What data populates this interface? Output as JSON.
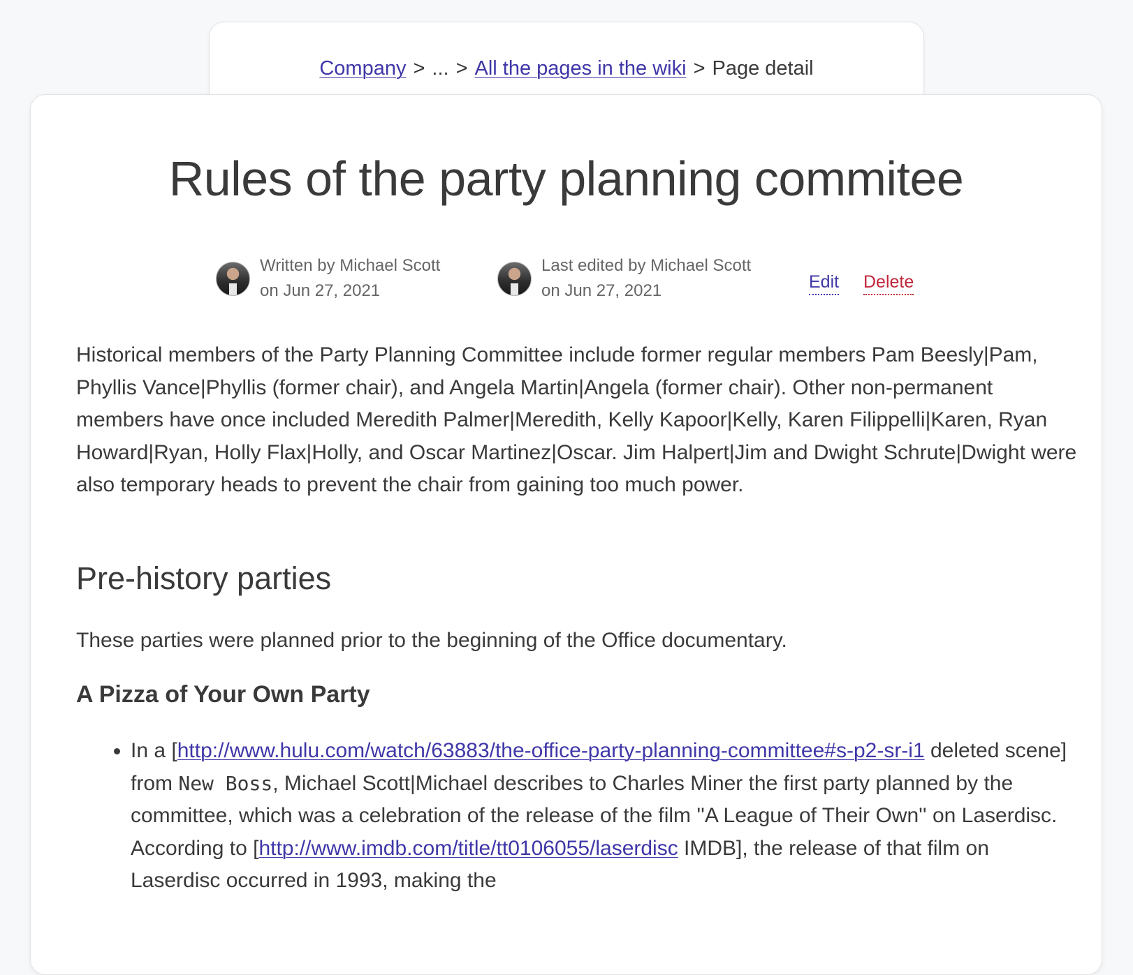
{
  "breadcrumb": {
    "company": "Company",
    "sep1": ">",
    "ellipsis": "...",
    "sep2": ">",
    "all_pages": "All the pages in the wiki",
    "sep3": ">",
    "current": "Page detail"
  },
  "page": {
    "title": "Rules of the party planning commitee"
  },
  "meta": {
    "written_line1": "Written by Michael Scott",
    "written_line2": "on Jun 27, 2021",
    "edited_line1": "Last edited by Michael Scott",
    "edited_line2": "on Jun 27, 2021",
    "edit_label": "Edit",
    "delete_label": "Delete"
  },
  "content": {
    "intro": "Historical members of the Party Planning Committee include former regular members Pam Beesly|Pam, Phyllis Vance|Phyllis (former chair), and Angela Martin|Angela (former chair). Other non-permanent members have once included Meredith Palmer|Meredith, Kelly Kapoor|Kelly, Karen Filippelli|Karen, Ryan Howard|Ryan, Holly Flax|Holly, and Oscar Martinez|Oscar. Jim Halpert|Jim and Dwight Schrute|Dwight were also temporary heads to prevent the chair from gaining too much power.",
    "section_heading": "Pre-history parties",
    "section_intro": "These parties were planned prior to the beginning of the Office documentary.",
    "sub_heading": "A Pizza of Your Own Party",
    "bullet": {
      "t1": "In a [",
      "link1": "http://www.hulu.com/watch/63883/the-office-party-planning-committee#s-p2-sr-i1",
      "t2": " deleted scene] from ",
      "code": "New Boss",
      "t3": ", Michael Scott|Michael describes to Charles Miner the first party planned by the committee, which was a celebration of the release of the film ''A League of Their Own'' on Laserdisc. According to [",
      "link2": "http://www.imdb.com/title/tt0106055/laserdisc",
      "t4": " IMDB], the release of that film on Laserdisc occurred in 1993, making the"
    }
  },
  "colors": {
    "link": "#3f37a8",
    "danger": "#c0263a",
    "text": "#3a3a3a",
    "background": "#f7f8fa"
  }
}
